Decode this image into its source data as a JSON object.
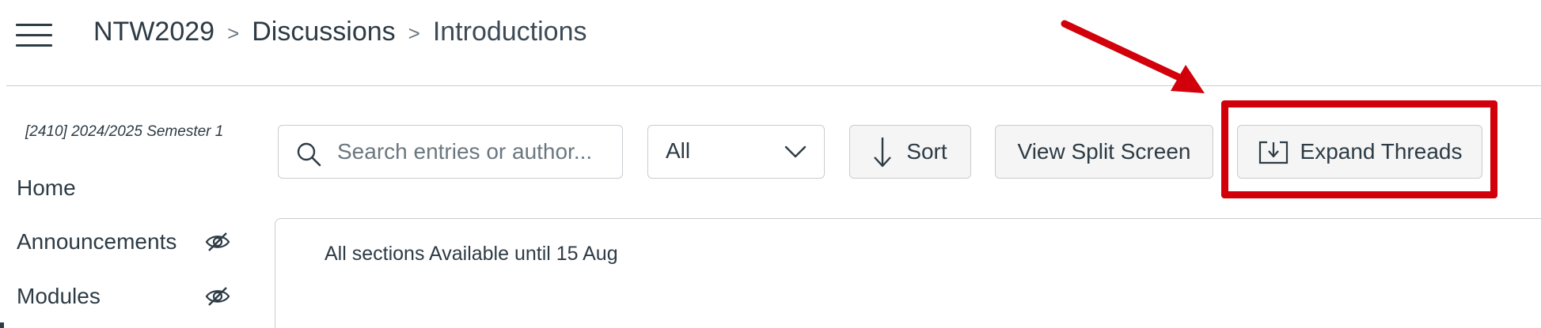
{
  "header": {
    "breadcrumb": {
      "course": "NTW2029",
      "section": "Discussions",
      "current": "Introductions",
      "separator": ">"
    }
  },
  "sidebar": {
    "term": "[2410] 2024/2025 Semester 1",
    "items": [
      {
        "label": "Home",
        "hidden_icon": false
      },
      {
        "label": "Announcements",
        "hidden_icon": true,
        "icon": "eye-slash-icon"
      },
      {
        "label": "Modules",
        "hidden_icon": true,
        "icon": "eye-slash-icon"
      }
    ]
  },
  "toolbar": {
    "search_placeholder": "Search entries or author...",
    "filter_selected": "All",
    "sort_label": "Sort",
    "split_screen_label": "View Split Screen",
    "expand_threads_label": "Expand Threads"
  },
  "discussion": {
    "availability": "All sections Available until 15 Aug"
  },
  "annotation": {
    "color": "#d1000a",
    "target": "Expand Threads"
  }
}
